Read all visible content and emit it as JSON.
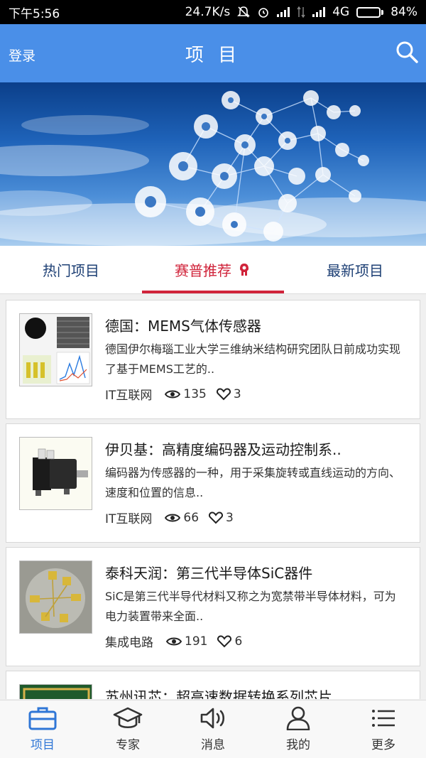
{
  "status_bar": {
    "time": "下午5:56",
    "net_speed": "24.7K/s",
    "network": "4G",
    "battery": "84%",
    "battery_level": 0.84
  },
  "header": {
    "login": "登录",
    "title": "项 目",
    "search_icon": "search-icon"
  },
  "tabs": [
    {
      "label": "热门项目",
      "active": false
    },
    {
      "label": "赛普推荐",
      "active": true,
      "badge_icon": "trophy-icon"
    },
    {
      "label": "最新项目",
      "active": false
    }
  ],
  "items": [
    {
      "title": "德国：MEMS气体传感器",
      "desc": "德国伊尔梅瑙工业大学三维纳米结构研究团队日前成功实现了基于MEMS工艺的..",
      "source": "IT互联网",
      "views": "135",
      "likes": "3"
    },
    {
      "title": "伊贝基：高精度编码器及运动控制系..",
      "desc": "编码器为传感器的一种，用于采集旋转或直线运动的方向、速度和位置的信息..",
      "source": "IT互联网",
      "views": "66",
      "likes": "3"
    },
    {
      "title": "泰科天润：第三代半导体SiC器件",
      "desc": "SiC是第三代半导代材料又称之为宽禁带半导体材料，可为电力装置带来全面..",
      "source": "集成电路",
      "views": "191",
      "likes": "6"
    },
    {
      "title": "苏州讯芯：超高速数据转换系列芯片",
      "desc": "",
      "source": "",
      "views": "",
      "likes": ""
    }
  ],
  "bottom_nav": [
    {
      "label": "项目",
      "icon": "briefcase-icon",
      "active": true
    },
    {
      "label": "专家",
      "icon": "graduation-cap-icon",
      "active": false
    },
    {
      "label": "消息",
      "icon": "speaker-icon",
      "active": false
    },
    {
      "label": "我的",
      "icon": "user-icon",
      "active": false
    },
    {
      "label": "更多",
      "icon": "menu-icon",
      "active": false
    }
  ],
  "colors": {
    "header": "#4a8fe8",
    "tab_active": "#d0233a",
    "tab_text": "#1d3f74",
    "nav_active": "#2f76d6"
  }
}
